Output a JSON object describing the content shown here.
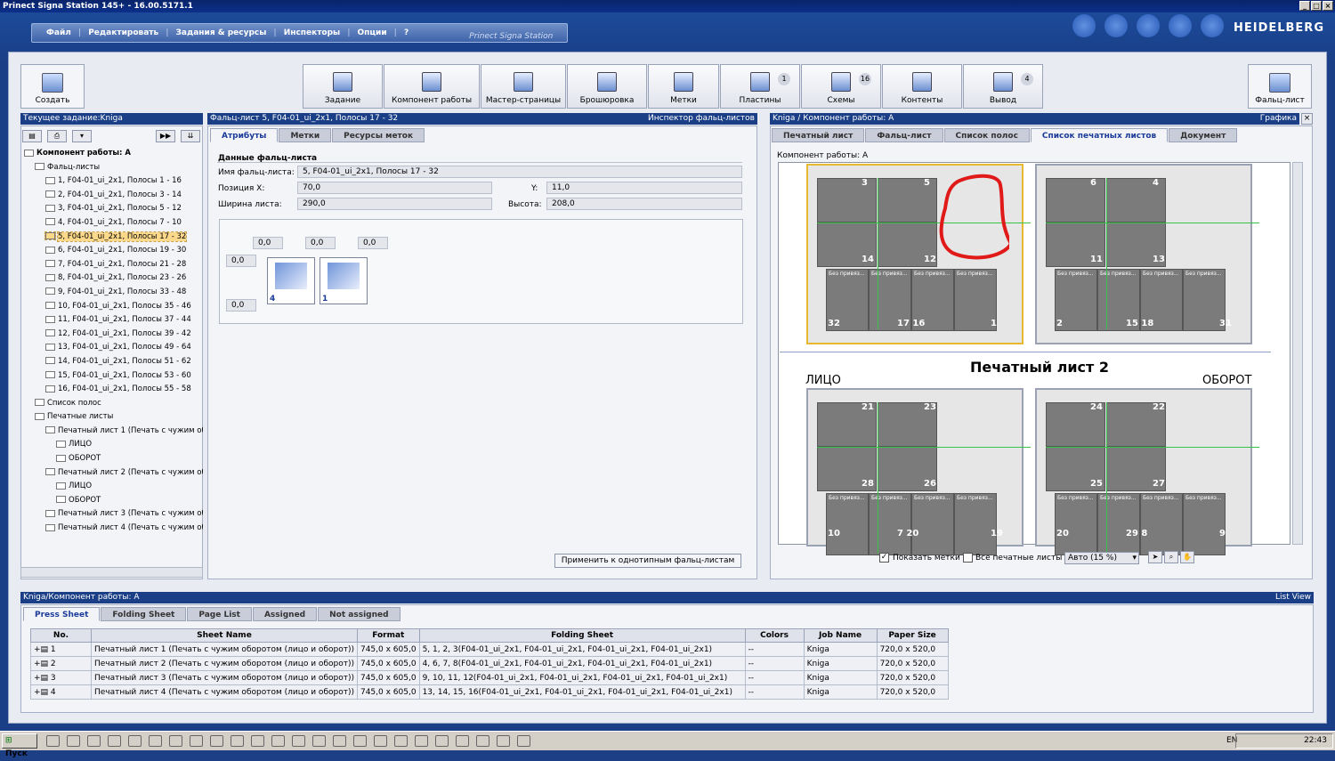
{
  "window": {
    "title": "Prinect Signa Station 145+  -  16.00.5171.1"
  },
  "menu": {
    "items": [
      "Файл",
      "Редактировать",
      "Задания & ресурсы",
      "Инспекторы",
      "Опции",
      "?"
    ],
    "brand": "Prinect Signa Station",
    "logo": "HEIDELBERG"
  },
  "toolbar": {
    "create_label": "Создать",
    "workflow": [
      {
        "label": "Задание",
        "badge": ""
      },
      {
        "label": "Компонент работы",
        "badge": ""
      },
      {
        "label": "Мастер-страницы",
        "badge": ""
      },
      {
        "label": "Брошюровка",
        "badge": ""
      },
      {
        "label": "Метки",
        "badge": ""
      },
      {
        "label": "Пластины",
        "badge": "1"
      },
      {
        "label": "Схемы",
        "badge": "16"
      },
      {
        "label": "Контенты",
        "badge": ""
      },
      {
        "label": "Вывод",
        "badge": "4"
      }
    ],
    "folding_sheet_label": "Фальц-лист"
  },
  "left_panel": {
    "header": "Текущее задание:Kniga",
    "tree": [
      {
        "text": "Компонент работы: A",
        "level": 0,
        "bold": true
      },
      {
        "text": "Фальц-листы",
        "level": 1
      },
      {
        "text": "1, F04-01_ui_2x1, Полосы 1 - 16",
        "level": 2
      },
      {
        "text": "2, F04-01_ui_2x1, Полосы 3 - 14",
        "level": 2
      },
      {
        "text": "3, F04-01_ui_2x1, Полосы 5 - 12",
        "level": 2
      },
      {
        "text": "4, F04-01_ui_2x1, Полосы 7 - 10",
        "level": 2
      },
      {
        "text": "5, F04-01_ui_2x1, Полосы 17 - 32",
        "level": 2,
        "selected": true
      },
      {
        "text": "6, F04-01_ui_2x1, Полосы 19 - 30",
        "level": 2
      },
      {
        "text": "7, F04-01_ui_2x1, Полосы 21 - 28",
        "level": 2
      },
      {
        "text": "8, F04-01_ui_2x1, Полосы 23 - 26",
        "level": 2
      },
      {
        "text": "9, F04-01_ui_2x1, Полосы 33 - 48",
        "level": 2
      },
      {
        "text": "10, F04-01_ui_2x1, Полосы 35 - 46",
        "level": 2
      },
      {
        "text": "11, F04-01_ui_2x1, Полосы 37 - 44",
        "level": 2
      },
      {
        "text": "12, F04-01_ui_2x1, Полосы 39 - 42",
        "level": 2
      },
      {
        "text": "13, F04-01_ui_2x1, Полосы 49 - 64",
        "level": 2
      },
      {
        "text": "14, F04-01_ui_2x1, Полосы 51 - 62",
        "level": 2
      },
      {
        "text": "15, F04-01_ui_2x1, Полосы 53 - 60",
        "level": 2
      },
      {
        "text": "16, F04-01_ui_2x1, Полосы 55 - 58",
        "level": 2
      },
      {
        "text": "Список полос",
        "level": 1
      },
      {
        "text": "Печатные листы",
        "level": 1
      },
      {
        "text": "Печатный лист 1 (Печать с чужим об",
        "level": 2
      },
      {
        "text": "ЛИЦО",
        "level": 3
      },
      {
        "text": "ОБОРОТ",
        "level": 3
      },
      {
        "text": "Печатный лист 2 (Печать с чужим об",
        "level": 2
      },
      {
        "text": "ЛИЦО",
        "level": 3
      },
      {
        "text": "ОБОРОТ",
        "level": 3
      },
      {
        "text": "Печатный лист 3 (Печать с чужим об",
        "level": 2
      },
      {
        "text": "Печатный лист 4 (Печать с чужим об",
        "level": 2
      }
    ]
  },
  "inspector": {
    "header_left": "Фальц-лист 5, F04-01_ui_2x1, Полосы 17 - 32",
    "header_right": "Инспектор фальц-листов",
    "tabs": [
      "Атрибуты",
      "Метки",
      "Ресурсы меток"
    ],
    "section_title": "Данные фальц-листа",
    "name_label": "Имя фальц-листа:",
    "name_value": "5, F04-01_ui_2x1, Полосы 17 - 32",
    "posx_label": "Позиция X:",
    "posx_value": "70,0",
    "y_label": "Y:",
    "y_value": "11,0",
    "width_label": "Ширина листа:",
    "width_value": "290,0",
    "height_label": "Высота:",
    "height_value": "208,0",
    "offsets": [
      "0,0",
      "0,0",
      "0,0",
      "0,0",
      "0,0"
    ],
    "page_nums": [
      "4",
      "1"
    ],
    "apply_button": "Применить к однотипным фальц-листам"
  },
  "graphic": {
    "header_left": "Kniga / Компонент работы: A",
    "header_right": "Графика",
    "tabs": [
      "Печатный лист",
      "Фальц-лист",
      "Список полос",
      "Список печатных листов",
      "Документ"
    ],
    "component_label": "Компонент работы: A",
    "sheet2_title": "Печатный лист 2",
    "front_label": "ЛИЦО",
    "back_label": "ОБОРОТ",
    "bez": "Без привяз...",
    "sheet1_front_nums": [
      "3",
      "5",
      "14",
      "12",
      "32",
      "17 16",
      "1"
    ],
    "sheet1_back_nums": [
      "6",
      "4",
      "11",
      "13",
      "2",
      "15 18",
      "31"
    ],
    "sheet2_front_nums": [
      "21",
      "23",
      "28",
      "26",
      "10",
      "7 20",
      "19"
    ],
    "sheet2_back_nums": [
      "24",
      "22",
      "25",
      "27",
      "20",
      "29 8",
      "9"
    ],
    "show_marks": "Показать метки",
    "all_sheets": "Все печатные листы",
    "zoom": "Авто (15 %)"
  },
  "bottom": {
    "header_left": "Kniga/Компонент работы: A",
    "header_right": "List View",
    "tabs": [
      "Press Sheet",
      "Folding Sheet",
      "Page List",
      "Assigned",
      "Not assigned"
    ],
    "columns": [
      "No.",
      "Sheet Name",
      "Format",
      "Folding Sheet",
      "Colors",
      "Job Name",
      "Paper Size"
    ],
    "rows": [
      [
        "1",
        "Печатный лист 1 (Печать с чужим оборотом (лицо и оборот))",
        "745,0 x 605,0",
        "5, 1, 2, 3(F04-01_ui_2x1, F04-01_ui_2x1, F04-01_ui_2x1, F04-01_ui_2x1)",
        "--",
        "Kniga",
        "720,0 x 520,0"
      ],
      [
        "2",
        "Печатный лист 2 (Печать с чужим оборотом (лицо и оборот))",
        "745,0 x 605,0",
        "4, 6, 7, 8(F04-01_ui_2x1, F04-01_ui_2x1, F04-01_ui_2x1, F04-01_ui_2x1)",
        "--",
        "Kniga",
        "720,0 x 520,0"
      ],
      [
        "3",
        "Печатный лист 3 (Печать с чужим оборотом (лицо и оборот))",
        "745,0 x 605,0",
        "9, 10, 11, 12(F04-01_ui_2x1, F04-01_ui_2x1, F04-01_ui_2x1, F04-01_ui_2x1)",
        "--",
        "Kniga",
        "720,0 x 520,0"
      ],
      [
        "4",
        "Печатный лист 4 (Печать с чужим оборотом (лицо и оборот))",
        "745,0 x 605,0",
        "13, 14, 15, 16(F04-01_ui_2x1, F04-01_ui_2x1, F04-01_ui_2x1, F04-01_ui_2x1)",
        "--",
        "Kniga",
        "720,0 x 520,0"
      ]
    ]
  },
  "taskbar": {
    "start": "Пуск",
    "lang": "EN",
    "time": "22:43"
  }
}
